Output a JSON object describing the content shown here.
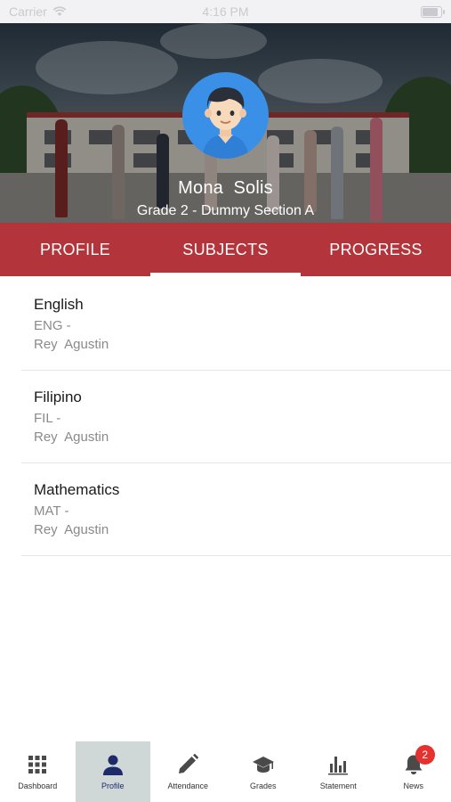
{
  "status_bar": {
    "carrier": "Carrier",
    "time": "4:16 PM"
  },
  "student": {
    "name": "Mona  Solis",
    "section": "Grade 2 - Dummy Section A"
  },
  "tabs": [
    {
      "label": "PROFILE",
      "active": false
    },
    {
      "label": "SUBJECTS",
      "active": true
    },
    {
      "label": "PROGRESS",
      "active": false
    }
  ],
  "subjects": [
    {
      "name": "English",
      "code": "ENG -",
      "teacher": "Rey  Agustin"
    },
    {
      "name": "Filipino",
      "code": "FIL -",
      "teacher": "Rey  Agustin"
    },
    {
      "name": "Mathematics",
      "code": "MAT -",
      "teacher": "Rey  Agustin"
    }
  ],
  "bottom_nav": [
    {
      "label": "Dashboard",
      "icon": "grid-icon",
      "active": false
    },
    {
      "label": "Profile",
      "icon": "person-icon",
      "active": true
    },
    {
      "label": "Attendance",
      "icon": "pencil-icon",
      "active": false
    },
    {
      "label": "Grades",
      "icon": "graduation-cap-icon",
      "active": false
    },
    {
      "label": "Statement",
      "icon": "bar-chart-icon",
      "active": false
    },
    {
      "label": "News",
      "icon": "bell-icon",
      "active": false,
      "badge": "2"
    }
  ],
  "colors": {
    "primary": "#b3343a",
    "nav_active_bg": "#cfd7d7",
    "nav_active_icon": "#1d2b6b",
    "badge": "#e5312f",
    "avatar_bg": "#3a8fe6"
  }
}
